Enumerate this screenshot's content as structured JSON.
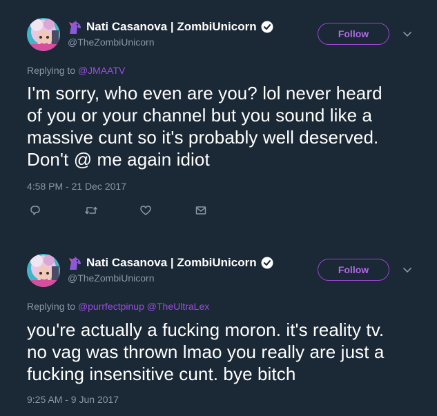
{
  "tweets": [
    {
      "author": {
        "name": "Nati Casanova | ZombiUnicorn",
        "handle": "@TheZombiUnicorn",
        "verified": true
      },
      "follow_label": "Follow",
      "replying": {
        "prefix": "Replying to",
        "mentions": [
          "@JMAATV"
        ]
      },
      "lines": [
        "I'm sorry, who even are you? lol never heard",
        "of you or your channel but you sound like a",
        "massive cunt so it's probably well deserved.",
        "Don't @ me again idiot"
      ],
      "timestamp": "4:58 PM - 21 Dec 2017",
      "actions": [
        "reply-icon",
        "retweet-icon",
        "like-icon",
        "message-icon"
      ]
    },
    {
      "author": {
        "name": "Nati Casanova | ZombiUnicorn",
        "handle": "@TheZombiUnicorn",
        "verified": true
      },
      "follow_label": "Follow",
      "replying": {
        "prefix": "Replying to",
        "mentions": [
          "@purrfectpinup",
          "@TheUltraLex"
        ]
      },
      "lines": [
        "you're actually a fucking moron. it's reality tv.",
        "no vag was thrown lmao you really are just a",
        "fucking insensitive cunt. bye bitch"
      ],
      "timestamp": "9:25 AM - 9 Jun 2017"
    }
  ],
  "colors": {
    "background": "#1b2836",
    "accent": "#9a47d1",
    "muted": "#8899a6",
    "text": "#ffffff"
  }
}
